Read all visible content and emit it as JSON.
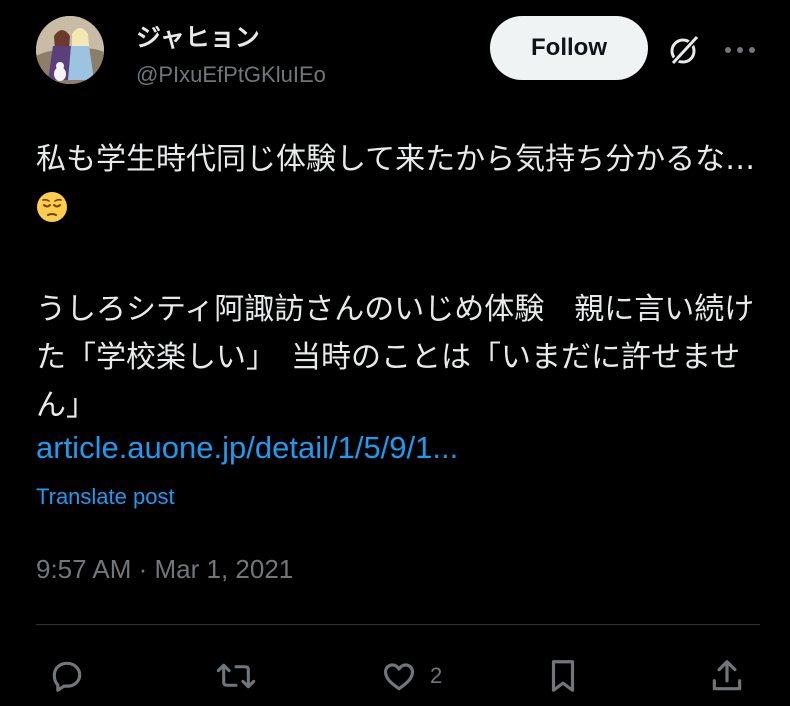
{
  "author": {
    "display_name": "ジャヒョン",
    "handle": "@PIxuEfPtGKluIEo"
  },
  "header": {
    "follow_label": "Follow"
  },
  "tweet": {
    "paragraph1": "私も学生時代同じ体験して来たから気持ち分かるな…",
    "emoji": "pensive-face",
    "paragraph2": "うしろシティ阿諏訪さんのいじめ体験　親に言い続けた「学校楽しい」　当時のことは「いまだに許せません」",
    "link": "article.auone.jp/detail/1/5/9/1...",
    "translate_label": "Translate post",
    "timestamp": "9:57 AM · Mar 1, 2021"
  },
  "actions": {
    "like_count": "2",
    "icons": [
      "reply-icon",
      "retweet-icon",
      "like-icon",
      "bookmark-icon",
      "share-icon"
    ]
  },
  "colors": {
    "background": "#000000",
    "text": "#e7e9ea",
    "muted": "#71767b",
    "accent": "#1d9bf0",
    "follow_bg": "#eff3f4"
  }
}
